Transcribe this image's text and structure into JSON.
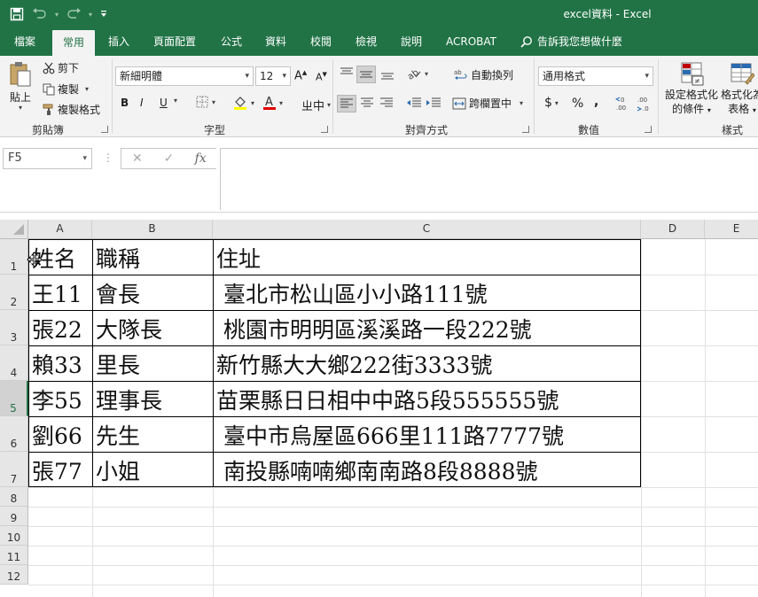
{
  "titlebar": {
    "title": "excel資料 - Excel",
    "bg_color": "#217346"
  },
  "tabs": [
    "檔案",
    "常用",
    "插入",
    "頁面配置",
    "公式",
    "資料",
    "校閱",
    "檢視",
    "說明",
    "ACROBAT"
  ],
  "tell_me": "告訴我您想做什麼",
  "ribbon": {
    "clipboard": {
      "paste": "貼上",
      "cut": "剪下",
      "copy": "複製",
      "format_painter": "複製格式",
      "label": "剪貼簿"
    },
    "font": {
      "font_name": "新細明體",
      "font_size": "12",
      "bold": "B",
      "italic": "I",
      "underline": "U",
      "phonetic": "中",
      "label": "字型"
    },
    "alignment": {
      "wrap_text": "自動換列",
      "merge_center": "跨欄置中",
      "label": "對齊方式"
    },
    "number": {
      "format": "通用格式",
      "currency": "$",
      "percent": "%",
      "comma": ",",
      "label": "數值"
    },
    "styles": {
      "conditional_line1": "設定格式化",
      "conditional_line2": "的條件",
      "table_line1": "格式化為",
      "table_line2": "表格",
      "label": "樣式"
    }
  },
  "formula_bar": {
    "name_box": "F5",
    "fx": "fx",
    "content": ""
  },
  "columns": [
    "A",
    "B",
    "C",
    "D",
    "E"
  ],
  "rows": [
    "1",
    "2",
    "3",
    "4",
    "5",
    "6",
    "7",
    "8",
    "9",
    "10",
    "11",
    "12"
  ],
  "selected_row": "5",
  "cells": [
    [
      "姓名",
      "職稱",
      "住址"
    ],
    [
      "王11",
      "會長",
      " 臺北市松山區小小路111號"
    ],
    [
      "張22",
      "大隊長",
      " 桃園市明明區溪溪路一段222號"
    ],
    [
      "賴33",
      "里長",
      "新竹縣大大鄉222街3333號"
    ],
    [
      "李55",
      "理事長",
      "苗栗縣日日相中中路5段555555號"
    ],
    [
      "劉66",
      "先生",
      " 臺中市烏屋區666里111路7777號"
    ],
    [
      "張77",
      "小姐",
      " 南投縣喃喃鄉南南路8段8888號"
    ]
  ]
}
